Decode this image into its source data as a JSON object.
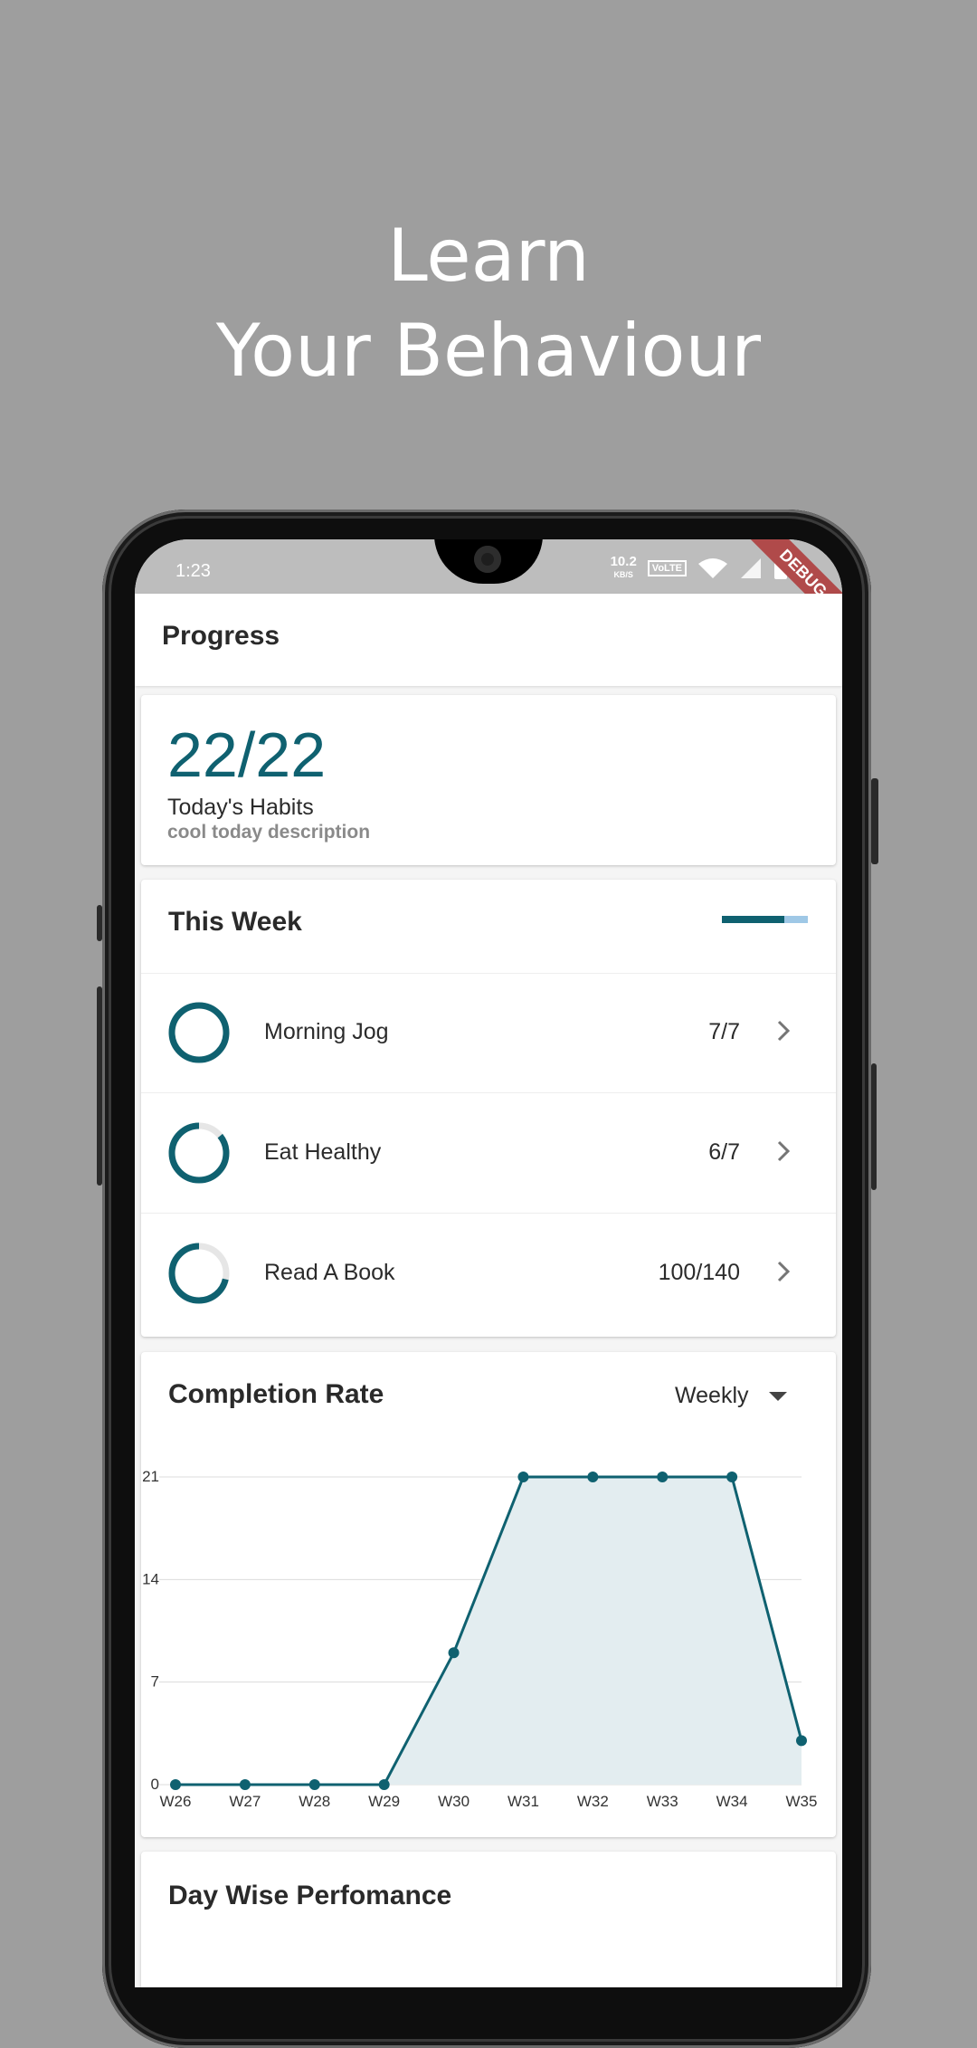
{
  "headline": {
    "line1": "Learn",
    "line2": "Your Behaviour"
  },
  "status_bar": {
    "time": "1:23",
    "net_speed": "10.2",
    "net_unit": "KB/S",
    "volte": "VoLTE",
    "debug_label": "DEBUG"
  },
  "app_bar": {
    "title": "Progress"
  },
  "today": {
    "count": "22/22",
    "label": "Today's Habits",
    "description": "cool today description"
  },
  "this_week": {
    "title": "This Week",
    "progress_fraction": 0.73,
    "habits": [
      {
        "name": "Morning Jog",
        "count": "7/7",
        "progress": 1.0
      },
      {
        "name": "Eat Healthy",
        "count": "6/7",
        "progress": 0.857
      },
      {
        "name": "Read A Book",
        "count": "100/140",
        "progress": 0.714
      }
    ]
  },
  "completion": {
    "title": "Completion Rate",
    "period": "Weekly"
  },
  "day_wise": {
    "title": "Day Wise Perfomance"
  },
  "colors": {
    "accent": "#0f6170",
    "ring_track": "#e6e6e6",
    "area_fill": "#e3edf0",
    "bar_light": "#9fc8e6"
  },
  "chart_data": {
    "type": "area",
    "categories": [
      "W26",
      "W27",
      "W28",
      "W29",
      "W30",
      "W31",
      "W32",
      "W33",
      "W34",
      "W35"
    ],
    "series": [
      {
        "values": [
          0,
          0,
          0,
          0,
          9,
          21,
          21,
          21,
          21,
          3
        ]
      }
    ],
    "yticks": [
      0,
      7,
      14,
      21
    ],
    "ylim": [
      0,
      21
    ],
    "grid": true
  }
}
